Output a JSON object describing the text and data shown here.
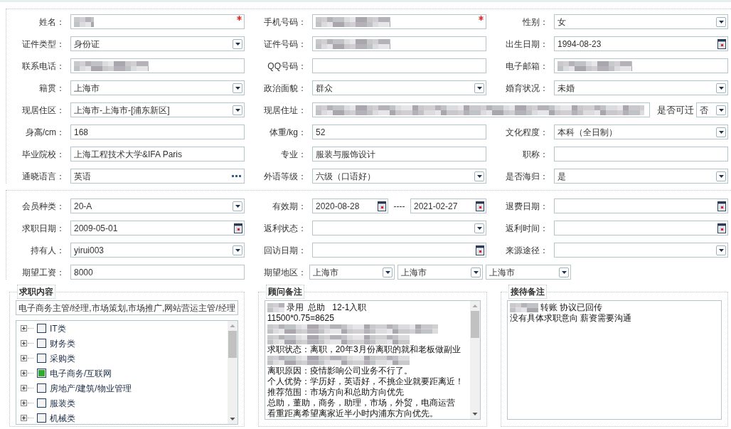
{
  "sections": [
    {
      "rows": [
        {
          "kind": "standard",
          "cells": [
            {
              "label": "姓名：",
              "field": {
                "kind": "text",
                "redacted": true,
                "required": true
              }
            },
            {
              "label": "手机号码：",
              "field": {
                "kind": "text",
                "redacted": true,
                "required": true
              }
            },
            {
              "label": "性别：",
              "field": {
                "kind": "select",
                "value": "女"
              }
            }
          ]
        },
        {
          "kind": "standard",
          "cells": [
            {
              "label": "证件类型：",
              "field": {
                "kind": "select",
                "value": "身份证"
              }
            },
            {
              "label": "证件号码：",
              "field": {
                "kind": "text",
                "redacted": true
              }
            },
            {
              "label": "出生日期：",
              "field": {
                "kind": "date",
                "value": "1994-08-23"
              }
            }
          ]
        },
        {
          "kind": "standard",
          "cells": [
            {
              "label": "联系电话：",
              "field": {
                "kind": "text",
                "redacted": true
              }
            },
            {
              "label": "QQ号码：",
              "field": {
                "kind": "text"
              }
            },
            {
              "label": "电子邮箱：",
              "field": {
                "kind": "text",
                "redacted": true
              }
            }
          ]
        },
        {
          "kind": "standard",
          "cells": [
            {
              "label": "籍贯：",
              "field": {
                "kind": "select",
                "value": "上海市"
              }
            },
            {
              "label": "政治面貌：",
              "field": {
                "kind": "select",
                "value": "群众"
              }
            },
            {
              "label": "婚育状况：",
              "field": {
                "kind": "select",
                "value": "未婚"
              }
            }
          ]
        },
        {
          "kind": "wide",
          "cells": [
            {
              "label": "现居住区：",
              "field": {
                "kind": "select",
                "value": "上海市-上海市-[浦东新区]"
              }
            },
            {
              "label": "现居住址：",
              "field": {
                "kind": "text",
                "redacted": true
              }
            },
            {
              "label": "是否可迁",
              "field": {
                "kind": "select",
                "value": "否"
              }
            }
          ]
        },
        {
          "kind": "standard",
          "cells": [
            {
              "label": "身高/cm：",
              "field": {
                "kind": "text",
                "value": "168"
              }
            },
            {
              "label": "体重/kg：",
              "field": {
                "kind": "text",
                "value": "52"
              }
            },
            {
              "label": "文化程度：",
              "field": {
                "kind": "select",
                "value": "本科（全日制）"
              }
            }
          ]
        },
        {
          "kind": "standard",
          "cells": [
            {
              "label": "毕业院校：",
              "field": {
                "kind": "text",
                "value": "上海工程技术大学&IFA Paris"
              }
            },
            {
              "label": "专业：",
              "field": {
                "kind": "text",
                "value": "服装与服饰设计"
              }
            },
            {
              "label": "职称：",
              "field": {
                "kind": "text"
              }
            }
          ]
        },
        {
          "kind": "standard",
          "cells": [
            {
              "label": "通晓语言：",
              "field": {
                "kind": "lookup",
                "value": "英语"
              }
            },
            {
              "label": "外语等级：",
              "field": {
                "kind": "select",
                "value": "六级（口语好）"
              }
            },
            {
              "label": "是否海归：",
              "field": {
                "kind": "select",
                "value": "是"
              }
            }
          ]
        }
      ]
    },
    {
      "rows": [
        {
          "kind": "standard",
          "cells": [
            {
              "label": "会员种类：",
              "field": {
                "kind": "select",
                "value": "20-A"
              }
            },
            {
              "label": "有效期：",
              "field": {
                "kind": "date_range",
                "values": [
                  "2020-08-28",
                  "2021-02-27"
                ],
                "separator": "----"
              }
            },
            {
              "label": "退费日期：",
              "field": {
                "kind": "date"
              }
            }
          ]
        },
        {
          "kind": "standard",
          "cells": [
            {
              "label": "求职日期：",
              "field": {
                "kind": "date",
                "value": "2009-05-01"
              }
            },
            {
              "label": "返利状态：",
              "field": {
                "kind": "select"
              }
            },
            {
              "label": "返利时间：",
              "field": {
                "kind": "date"
              }
            }
          ]
        },
        {
          "kind": "standard",
          "cells": [
            {
              "label": "持有人：",
              "field": {
                "kind": "select",
                "value": "yirui003"
              }
            },
            {
              "label": "回访日期：",
              "field": {
                "kind": "date"
              }
            },
            {
              "label": "来源途径：",
              "field": {
                "kind": "select"
              }
            }
          ]
        },
        {
          "kind": "standard",
          "cells": [
            {
              "label": "期望工资：",
              "field": {
                "kind": "text",
                "value": "8000"
              }
            },
            {
              "label": "期望地区：",
              "field": {
                "kind": "multi_select",
                "values": [
                  "上海市",
                  "上海市",
                  "上海市"
                ]
              }
            }
          ]
        }
      ]
    }
  ],
  "job_panel": {
    "title": "求职内容",
    "selection": "电子商务主管/经理,市场策划,市场推广,网站营运主管/经理",
    "tree": [
      {
        "label": "IT类",
        "checked": false,
        "expanded": false
      },
      {
        "label": "财务类",
        "checked": false,
        "expanded": false
      },
      {
        "label": "采购类",
        "checked": false,
        "expanded": false
      },
      {
        "label": "电子商务/互联网",
        "checked": true,
        "expanded": false
      },
      {
        "label": "房地产/建筑/物业管理",
        "checked": false,
        "expanded": false
      },
      {
        "label": "服装类",
        "checked": false,
        "expanded": false
      },
      {
        "label": "机械类",
        "checked": false,
        "expanded": false
      }
    ]
  },
  "note_panels": [
    {
      "title": "顾问备注",
      "scrollbar": true,
      "lines": [
        {
          "kind": "masked_prefix",
          "text": "录用  总助   12-1入职"
        },
        {
          "kind": "text",
          "text": "11500*0.75=8625"
        },
        {
          "kind": "redacted"
        },
        {
          "kind": "redacted"
        },
        {
          "kind": "text",
          "text": "求职状态：离职，20年3月份离职的就和老板做副业"
        },
        {
          "kind": "redacted"
        },
        {
          "kind": "text",
          "text": "离职原因：疫情影响公司业务不行了。"
        },
        {
          "kind": "text",
          "text": "个人优势：学历好，英语好，不挑企业就要距离近！"
        },
        {
          "kind": "text",
          "text": "推荐范围：市场方向和总助方向优先"
        },
        {
          "kind": "text",
          "text": "总助，董助，商务，助理，市场，外贸，电商运营"
        },
        {
          "kind": "text",
          "text": "看重距离希望离家近半小时内浦东方向优先。"
        }
      ]
    },
    {
      "title": "接待备注",
      "scrollbar": false,
      "lines": [
        {
          "kind": "masked_prefix",
          "text": "转账 协议已回传"
        },
        {
          "kind": "text",
          "text": "没有具体求职意向 薪资需要沟通"
        }
      ]
    }
  ]
}
